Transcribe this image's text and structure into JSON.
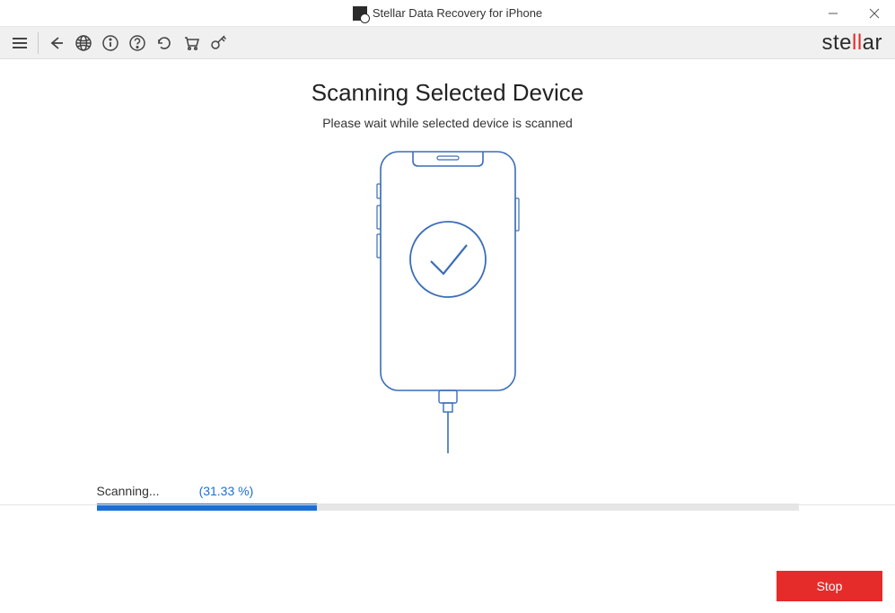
{
  "window": {
    "title": "Stellar Data Recovery for iPhone"
  },
  "brand": {
    "pre": "ste",
    "l1": "l",
    "l2": "l",
    "post": "ar"
  },
  "main": {
    "heading": "Scanning Selected Device",
    "subheading": "Please wait while selected device is scanned"
  },
  "progress": {
    "label": "Scanning...",
    "percent_text": "(31.33 %)",
    "percent_value": 31.33
  },
  "footer": {
    "stop_label": "Stop"
  }
}
